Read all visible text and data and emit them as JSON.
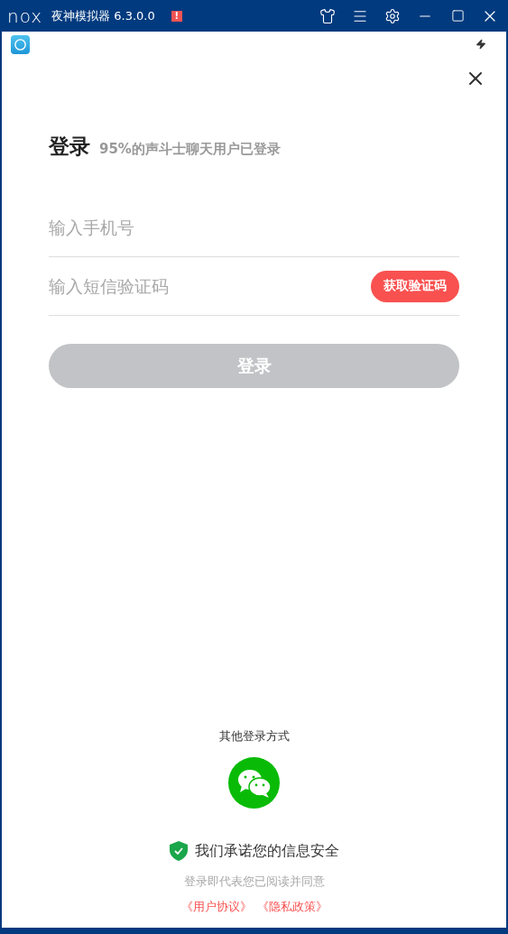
{
  "window": {
    "logo": "nox",
    "title": "夜神模拟器 6.3.0.0",
    "alert": "!"
  },
  "login": {
    "title": "登录",
    "subtitle": "95%的声斗士聊天用户已登录",
    "phone_field": {
      "placeholder": "输入手机号"
    },
    "code_field": {
      "placeholder": "输入短信验证码"
    },
    "get_code_button": "获取验证码",
    "login_button": {
      "label": "登录",
      "disabled": true
    }
  },
  "footer": {
    "other_methods": "其他登录方式",
    "security_note": "我们承诺您的信息安全",
    "agreement_note": "登录即代表您已阅读并同意",
    "links": [
      "《用户协议》",
      "《隐私政策》"
    ]
  }
}
